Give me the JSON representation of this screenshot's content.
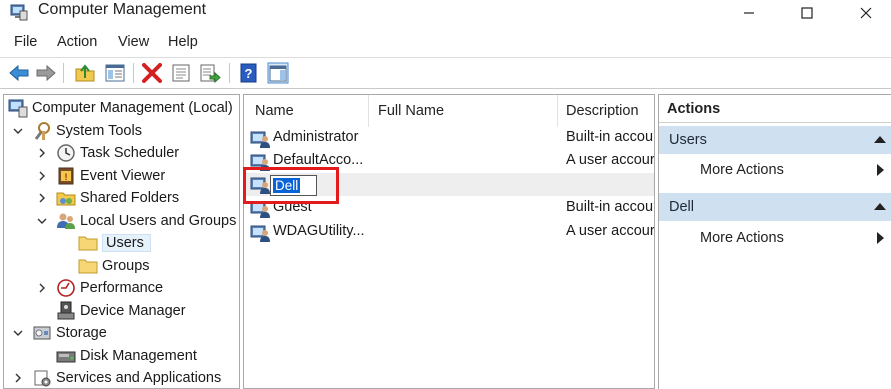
{
  "window": {
    "title": "Computer Management",
    "controls": [
      "minimize",
      "maximize",
      "close"
    ]
  },
  "menu": [
    "File",
    "Action",
    "View",
    "Help"
  ],
  "toolbar": [
    "back-icon",
    "forward-icon",
    "up-folder-icon",
    "show-hide-tree-icon",
    "delete-icon",
    "properties-icon",
    "export-list-icon",
    "help-icon",
    "show-hide-action-pane-icon"
  ],
  "tree": {
    "root": "Computer Management (Local)",
    "system_tools": "System Tools",
    "task_scheduler": "Task Scheduler",
    "event_viewer": "Event Viewer",
    "shared_folders": "Shared Folders",
    "local_users_groups": "Local Users and Groups",
    "users": "Users",
    "groups": "Groups",
    "performance": "Performance",
    "device_manager": "Device Manager",
    "storage": "Storage",
    "disk_management": "Disk Management",
    "services_apps": "Services and Applications"
  },
  "list": {
    "columns": [
      "Name",
      "Full Name",
      "Description"
    ],
    "rows": [
      {
        "name": "Administrator",
        "full_name": "",
        "description": "Built-in accou"
      },
      {
        "name": "DefaultAcco...",
        "full_name": "",
        "description": "A user accour"
      },
      {
        "name": "Dell",
        "full_name": "",
        "description": ""
      },
      {
        "name": "Guest",
        "full_name": "",
        "description": "Built-in accou"
      },
      {
        "name": "WDAGUtility...",
        "full_name": "",
        "description": "A user accour"
      }
    ],
    "rename_value": "Dell"
  },
  "actions": {
    "title": "Actions",
    "section1": "Users",
    "section1_item": "More Actions",
    "section2": "Dell",
    "section2_item": "More Actions"
  },
  "colors": {
    "highlight_box": "#e21c1c",
    "selection_blue": "#0a63d6",
    "actions_header": "#cfe0f1"
  }
}
